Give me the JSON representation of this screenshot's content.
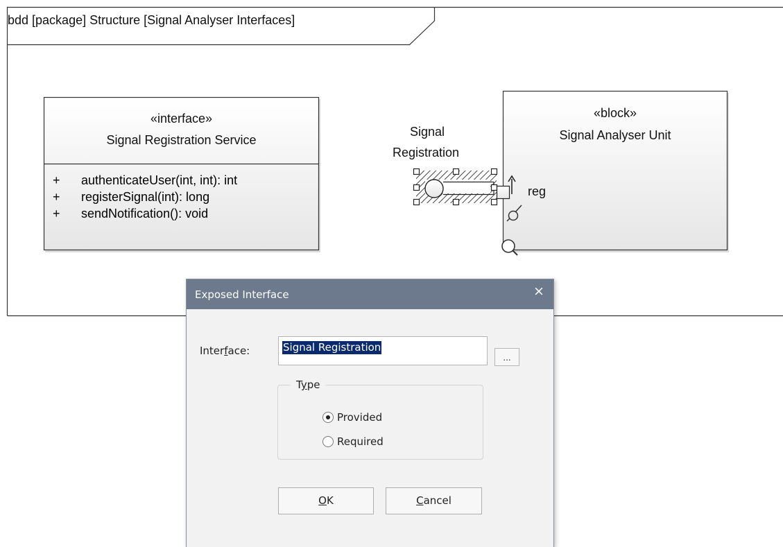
{
  "diagram": {
    "frame_title": "bdd  [package] Structure [Signal Analyser Interfaces]",
    "interface_block": {
      "stereotype": "«interface»",
      "name": "Signal Registration Service",
      "operations": [
        {
          "visibility": "+",
          "signature": "authenticateUser(int, int): int"
        },
        {
          "visibility": "+",
          "signature": "registerSignal(int): long"
        },
        {
          "visibility": "+",
          "signature": "sendNotification(): void"
        }
      ]
    },
    "port_label": "reg",
    "interface_label_line1": "Signal",
    "interface_label_line2": "Registration",
    "block": {
      "stereotype": "«block»",
      "name": "Signal Analyser Unit"
    }
  },
  "dialog": {
    "title": "Exposed Interface",
    "close_glyph": "×",
    "interface_label_pre": "Inter",
    "interface_label_mnemonic": "f",
    "interface_label_post": "ace:",
    "interface_value": "Signal Registration",
    "browse_label": "...",
    "type_group_pre": "T",
    "type_group_mnemonic": "y",
    "type_group_post": "pe",
    "options": [
      {
        "label": "Provided",
        "selected": true
      },
      {
        "label": "Required",
        "selected": false
      }
    ],
    "ok_mnemonic": "O",
    "ok_rest": "K",
    "cancel_mnemonic": "C",
    "cancel_rest": "ancel"
  },
  "colors": {
    "titlebar": "#6d7a8d",
    "selection": "#0a2a6e",
    "dialog_bg": "#f2f2f2"
  }
}
